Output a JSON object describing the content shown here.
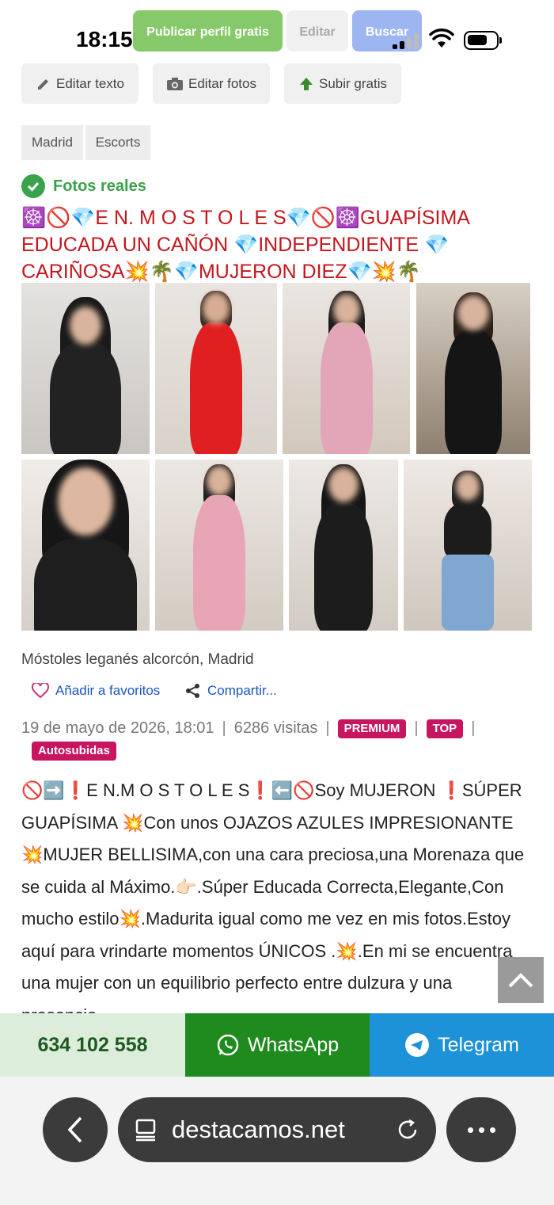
{
  "status": {
    "time": "18:15"
  },
  "top_buttons": {
    "publish": "Publicar perfil gratis",
    "edit": "Editar",
    "search": "Buscar"
  },
  "actions": {
    "edit_text": "Editar texto",
    "edit_photos": "Editar fotos",
    "upload": "Subir gratis"
  },
  "tags": [
    "Madrid",
    "Escorts"
  ],
  "verified": "Fotos reales",
  "title": "☸️🚫💎E N. M O S T O L E S💎🚫☸️GUAPÍSIMA EDUCADA UN CAÑÓN 💎INDEPENDIENTE 💎 CARIÑOSA💥🌴💎MUJERON DIEZ💎💥🌴",
  "location": "Móstoles leganés alcorcón, Madrid",
  "links": {
    "favorite": "Añadir a favoritos",
    "share": "Compartir..."
  },
  "meta": {
    "date": "19 de mayo de 2026, 18:01",
    "visits": "6286 visitas",
    "badges": [
      "PREMIUM",
      "TOP",
      "Autosubidas"
    ]
  },
  "description": "🚫➡️❗E N.M O S T O L E S❗⬅️🚫Soy MUJERON ❗SÚPER GUAPÍSIMA 💥Con unos OJAZOS AZULES IMPRESIONANTE💥MUJER BELLISIMA,con una cara preciosa,una Morenaza que se cuida al Máximo.👉🏻.Súper Educada Correcta,Elegante,Con mucho estilo💥.Madurita igual como me vez en mis fotos.Estoy aquí para vrindarte momentos ÚNICOS .💥.En mi se encuentra una mujer con un equilibrio perfecto entre dulzura y una presencia",
  "contact": {
    "phone": "634 102 558",
    "whatsapp": "WhatsApp",
    "telegram": "Telegram"
  },
  "browser": {
    "url": "destacamos.net"
  },
  "colors": {
    "title_red": "#c5161d",
    "verified_green": "#3aa24c",
    "badge_pink": "#c8155f",
    "whatsapp_green": "#1f8b1f",
    "telegram_blue": "#1e92d8"
  }
}
